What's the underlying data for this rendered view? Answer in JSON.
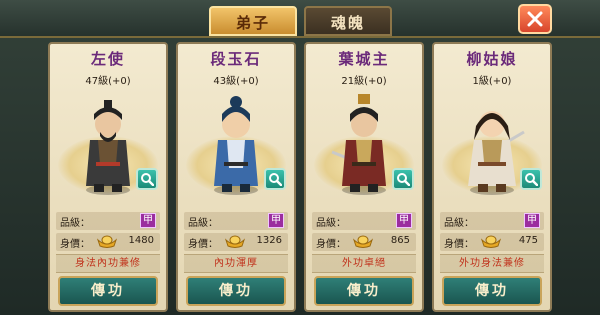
{
  "tabs": {
    "disciples": "弟子",
    "soul": "魂魄"
  },
  "cards": [
    {
      "name": "左使",
      "level": "47級(+0)",
      "grade_label": "品級：",
      "grade": "甲",
      "price_label": "身價：",
      "price": "1480",
      "trait": "身法內功兼修",
      "action": "傳功",
      "robe": "#3a3a3a"
    },
    {
      "name": "段玉石",
      "level": "43級(+0)",
      "grade_label": "品級：",
      "grade": "甲",
      "price_label": "身價：",
      "price": "1326",
      "trait": "內功渾厚",
      "action": "傳功",
      "robe": "#3b6aa8"
    },
    {
      "name": "葉城主",
      "level": "21級(+0)",
      "grade_label": "品級：",
      "grade": "甲",
      "price_label": "身價：",
      "price": "865",
      "trait": "外功卓絕",
      "action": "傳功",
      "robe": "#7a2a24"
    },
    {
      "name": "柳姑娘",
      "level": "1級(+0)",
      "grade_label": "品級：",
      "grade": "甲",
      "price_label": "身價：",
      "price": "475",
      "trait": "外功身法兼修",
      "action": "傳功",
      "robe": "#e8dfcf"
    }
  ],
  "colors": {
    "accent_gold": "#e2b14d",
    "grade_badge": "#9b2d9f",
    "trait_text": "#c0311b",
    "button_teal": "#2f7f77"
  }
}
